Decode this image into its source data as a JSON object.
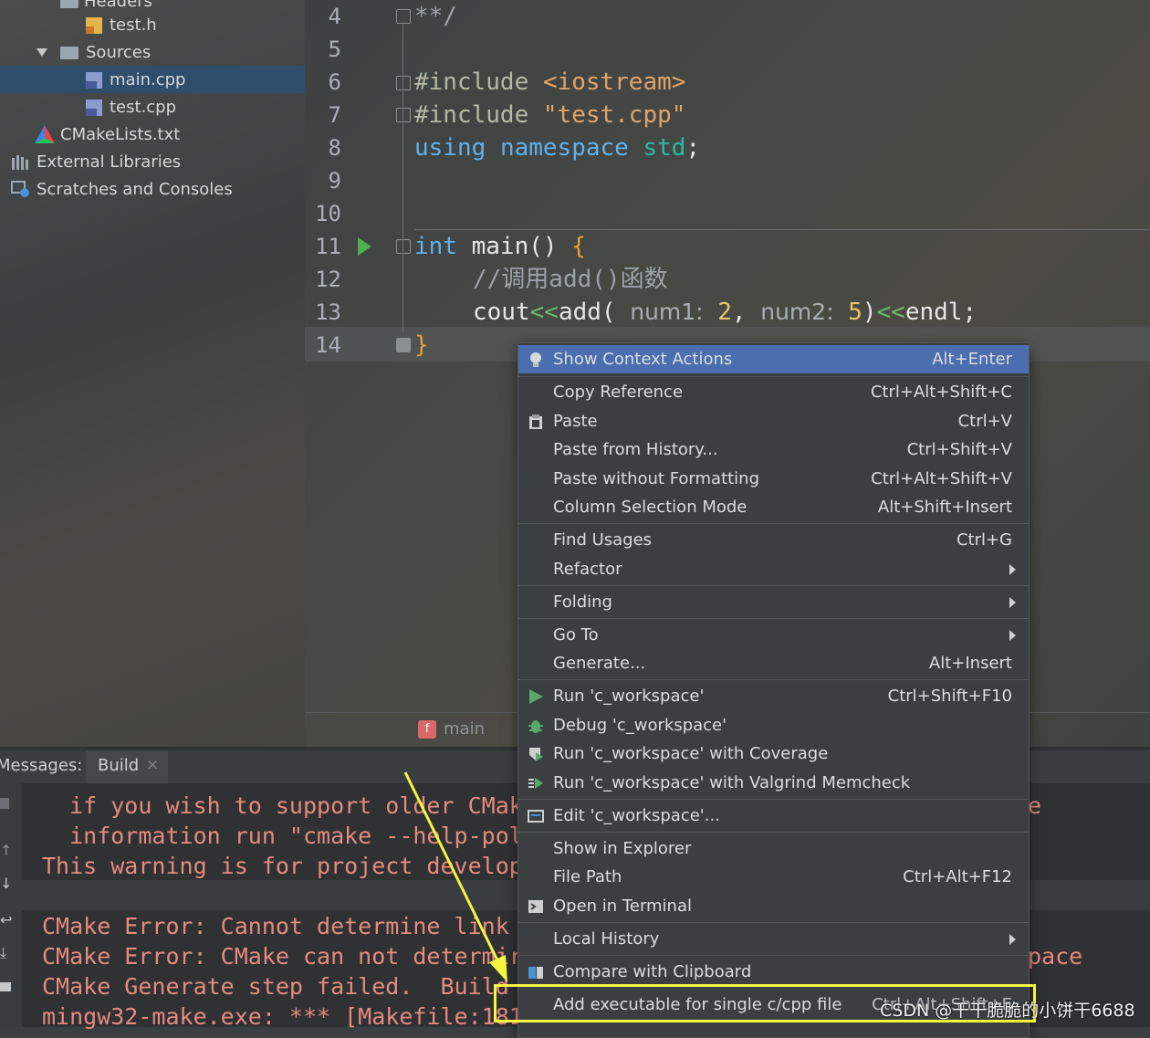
{
  "tree": {
    "items": [
      {
        "label": "Headers"
      },
      {
        "label": "test.h"
      },
      {
        "label": "Sources"
      },
      {
        "label": "main.cpp"
      },
      {
        "label": "test.cpp"
      },
      {
        "label": "CMakeLists.txt"
      },
      {
        "label": "External Libraries"
      },
      {
        "label": "Scratches and Consoles"
      }
    ]
  },
  "editor": {
    "line_numbers": [
      "4",
      "5",
      "6",
      "7",
      "8",
      "9",
      "10",
      "11",
      "12",
      "13",
      "14"
    ],
    "code": {
      "l4": "**/",
      "l6_kw": "#include",
      "l6_str": "<iostream>",
      "l7_kw": "#include",
      "l7_str": "\"test.cpp\"",
      "l8_a": "using",
      "l8_b": "namespace",
      "l8_c": "std",
      "l8_d": ";",
      "l11_a": "int",
      "l11_b": " main() ",
      "l11_c": "{",
      "l12": "//调用add()函数",
      "l13_a": "cout",
      "l13_op1": "<<",
      "l13_b": "add( ",
      "l13_h1": "num1:",
      "l13_n1": " 2",
      "l13_c": ", ",
      "l13_h2": "num2:",
      "l13_n2": " 5",
      "l13_d": ")",
      "l13_op2": "<<",
      "l13_e": "endl;",
      "l14": "}"
    },
    "breadcrumb": "main",
    "breadcrumb_badge": "f"
  },
  "messages": {
    "title": "Messages:",
    "tab": "Build",
    "lines": [
      "  if you wish to support older CMak",
      "  information run \"cmake --help-pol",
      "This warning is for project develop",
      "",
      "CMake Error: Cannot determine link",
      "CMake Error: CMake can not determir",
      "CMake Generate step failed.  Build",
      "mingw32-make.exe: *** [Makefile:181"
    ],
    "right_fragments": [
      "e",
      "pace"
    ]
  },
  "menu": {
    "items": [
      {
        "label": "Show Context Actions",
        "shortcut": "Alt+Enter",
        "icon": "bulb-icon"
      },
      {
        "label": "Copy Reference",
        "shortcut": "Ctrl+Alt+Shift+C"
      },
      {
        "label": "Paste",
        "shortcut": "Ctrl+V",
        "icon": "clipboard-icon"
      },
      {
        "label": "Paste from History...",
        "shortcut": "Ctrl+Shift+V"
      },
      {
        "label": "Paste without Formatting",
        "shortcut": "Ctrl+Alt+Shift+V"
      },
      {
        "label": "Column Selection Mode",
        "shortcut": "Alt+Shift+Insert"
      },
      {
        "label": "Find Usages",
        "shortcut": "Ctrl+G"
      },
      {
        "label": "Refactor",
        "shortcut": ""
      },
      {
        "label": "Folding",
        "shortcut": ""
      },
      {
        "label": "Go To",
        "shortcut": ""
      },
      {
        "label": "Generate...",
        "shortcut": "Alt+Insert"
      },
      {
        "label": "Run 'c_workspace'",
        "shortcut": "Ctrl+Shift+F10",
        "icon": "run-icon"
      },
      {
        "label": "Debug 'c_workspace'",
        "shortcut": "",
        "icon": "debug-icon"
      },
      {
        "label": "Run 'c_workspace' with Coverage",
        "shortcut": "",
        "icon": "coverage-icon"
      },
      {
        "label": "Run 'c_workspace' with Valgrind Memcheck",
        "shortcut": "",
        "icon": "valgrind-icon"
      },
      {
        "label": "Edit 'c_workspace'...",
        "shortcut": "",
        "icon": "edit-config-icon"
      },
      {
        "label": "Show in Explorer",
        "shortcut": ""
      },
      {
        "label": "File Path",
        "shortcut": "Ctrl+Alt+F12"
      },
      {
        "label": "Open in Terminal",
        "shortcut": "",
        "icon": "terminal-icon"
      },
      {
        "label": "Local History",
        "shortcut": ""
      },
      {
        "label": "Compare with Clipboard",
        "shortcut": "",
        "icon": "compare-icon"
      },
      {
        "label": "Add executable for single c/cpp file",
        "shortcut": "Ctrl+Alt+Shift+E"
      }
    ]
  },
  "watermark": "CSDN @干干脆脆的小饼干6688",
  "colors": {
    "selection": "#4b6eaf",
    "annotation": "#f5f542",
    "keyword": "#5fb1ee",
    "string": "#e0a36a",
    "error_text": "#e58a7e"
  }
}
